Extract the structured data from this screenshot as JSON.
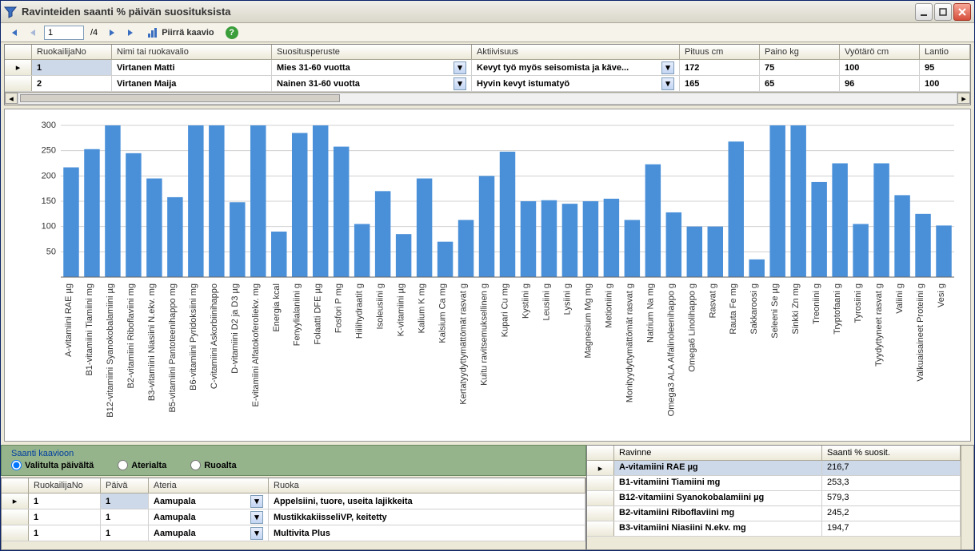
{
  "window": {
    "title": "Ravinteiden saanti % päivän suosituksista"
  },
  "toolbar": {
    "page_current": "1",
    "page_total": "/4",
    "chart_button": "Piirrä kaavio"
  },
  "topgrid": {
    "headers": [
      "RuokailijaNo",
      "Nimi tai ruokavalio",
      "Suositusperuste",
      "Aktiivisuus",
      "Pituus cm",
      "Paino kg",
      "Vyötärö cm",
      "Lantio"
    ],
    "rows": [
      {
        "no": "1",
        "nimi": "Virtanen Matti",
        "suositus": "Mies 31-60 vuotta",
        "aktiivisuus": "Kevyt työ myös seisomista ja käve...",
        "pituus": "172",
        "paino": "75",
        "vyotaro": "100",
        "lantio": "95"
      },
      {
        "no": "2",
        "nimi": "Virtanen Maija",
        "suositus": "Nainen 31-60 vuotta",
        "aktiivisuus": "Hyvin kevyt istumatyö",
        "pituus": "165",
        "paino": "65",
        "vyotaro": "96",
        "lantio": "100"
      }
    ]
  },
  "chart_data": {
    "type": "bar",
    "ylim": [
      0,
      300
    ],
    "yticks": [
      50,
      100,
      150,
      200,
      250,
      300
    ],
    "categories": [
      "A-vitamiini RAE µg",
      "B1-vitamiini Tiamiini mg",
      "B12-vitamiini Syanokobalamiini µg",
      "B2-vitamiini Riboflaviini mg",
      "B3-vitamiini Niasiini N.ekv. mg",
      "B5-vitamiini Pantoteenihappo mg",
      "B6-vitamiini Pyridoksiini mg",
      "C-vitamiini Askorbiinihappo",
      "D-vitamiini D2 ja D3 µg",
      "E-vitamiini Alfatokoferoliekv. mg",
      "Energia kcal",
      "Fenyylialaniini g",
      "Folaatti DFE µg",
      "Fosfori P mg",
      "Hiilihydraatit g",
      "Isoleusiini g",
      "K-vitamiini µg",
      "Kalium K mg",
      "Kalsium Ca mg",
      "Kertatyydyttymättömät rasvat g",
      "Kuitu ravitsemuksellinen g",
      "Kupari Cu mg",
      "Kystiini g",
      "Leusiini g",
      "Lysiini g",
      "Magnesium Mg mg",
      "Metioniini g",
      "Monityydyttymättömät rasvat g",
      "Natrium Na mg",
      "Omega3 ALA Alfalinoleenihappo g",
      "Omega6 Linolihappo g",
      "Rasvat g",
      "Rauta Fe mg",
      "Sakkaroosi g",
      "Seleeni Se µg",
      "Sinkki Zn mg",
      "Treoniini g",
      "Tryptofaani g",
      "Tyrosiini g",
      "Tyydyttyneet rasvat g",
      "Valiini g",
      "Valkuaisaineet Proteiini g",
      "Vesi g"
    ],
    "values": [
      217,
      253,
      300,
      245,
      195,
      158,
      300,
      300,
      148,
      300,
      90,
      285,
      300,
      258,
      105,
      170,
      85,
      195,
      70,
      113,
      200,
      248,
      150,
      152,
      145,
      150,
      155,
      113,
      223,
      128,
      100,
      100,
      268,
      35,
      300,
      300,
      188,
      225,
      105,
      225,
      162,
      125,
      102
    ]
  },
  "radio": {
    "legend": "Saanti kaavioon",
    "options": [
      "Valitulta päivältä",
      "Aterialta",
      "Ruoalta"
    ],
    "selected": 0
  },
  "bottomgrid": {
    "headers": [
      "RuokailijaNo",
      "Päivä",
      "Ateria",
      "Ruoka"
    ],
    "rows": [
      {
        "no": "1",
        "paiva": "1",
        "ateria": "Aamupala",
        "ruoka": "Appelsiini, tuore, useita lajikkeita"
      },
      {
        "no": "1",
        "paiva": "1",
        "ateria": "Aamupala",
        "ruoka": "MustikkakiisseliVP, keitetty"
      },
      {
        "no": "1",
        "paiva": "1",
        "ateria": "Aamupala",
        "ruoka": "Multivita Plus"
      }
    ]
  },
  "rightgrid": {
    "headers": [
      "Ravinne",
      "Saanti % suosit."
    ],
    "rows": [
      {
        "ravinne": "A-vitamiini RAE µg",
        "val": "216,7",
        "sel": true
      },
      {
        "ravinne": "B1-vitamiini Tiamiini mg",
        "val": "253,3"
      },
      {
        "ravinne": "B12-vitamiini Syanokobalamiini µg",
        "val": "579,3"
      },
      {
        "ravinne": "B2-vitamiini Riboflaviini mg",
        "val": "245,2"
      },
      {
        "ravinne": "B3-vitamiini Niasiini N.ekv. mg",
        "val": "194,7"
      }
    ]
  }
}
